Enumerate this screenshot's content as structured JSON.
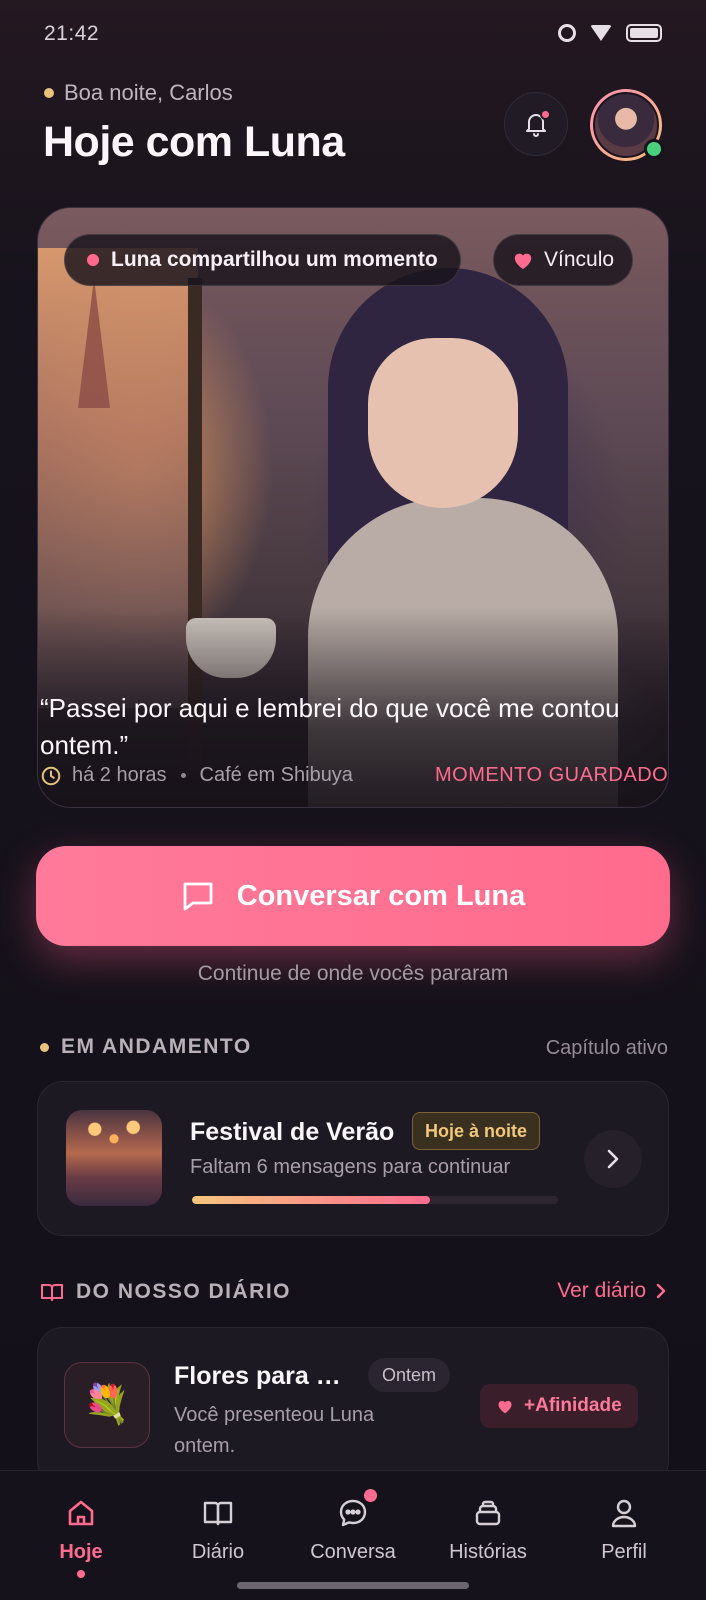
{
  "status_bar": {
    "time": "21:42"
  },
  "header": {
    "greeting": "Boa noite, Carlos",
    "title": "Hoje com Luna"
  },
  "hero": {
    "moment_tag": "Luna compartilhou um momento",
    "bond_tag": "Vínculo",
    "quote": "“Passei por aqui e lembrei do que você me contou ontem.”",
    "time_ago": "há 2 horas",
    "location": "Café em Shibuya",
    "saved_label": "MOMENTO GUARDADO"
  },
  "cta": {
    "label": "Conversar com Luna",
    "subtitle": "Continue de onde vocês pararam"
  },
  "in_progress": {
    "section_title": "EM ANDAMENTO",
    "section_right": "Capítulo ativo",
    "title": "Festival de Verão",
    "badge": "Hoje à noite",
    "subtitle": "Faltam 6 mensagens para continuar",
    "progress_fraction": 0.65
  },
  "diary": {
    "section_title": "DO NOSSO DIÁRIO",
    "see_all": "Ver diário",
    "entry_title": "Flores para Luna",
    "entry_when": "Ontem",
    "entry_desc": "Você presenteou Luna ontem.",
    "entry_emoji": "💐",
    "entry_tag": "+Afinidade"
  },
  "nav": {
    "items": [
      {
        "label": "Hoje"
      },
      {
        "label": "Diário"
      },
      {
        "label": "Conversa"
      },
      {
        "label": "Histórias"
      },
      {
        "label": "Perfil"
      }
    ],
    "active": "Hoje"
  },
  "colors": {
    "accent": "#ff6b8f",
    "gold": "#e7c27a",
    "background": "#131019"
  }
}
